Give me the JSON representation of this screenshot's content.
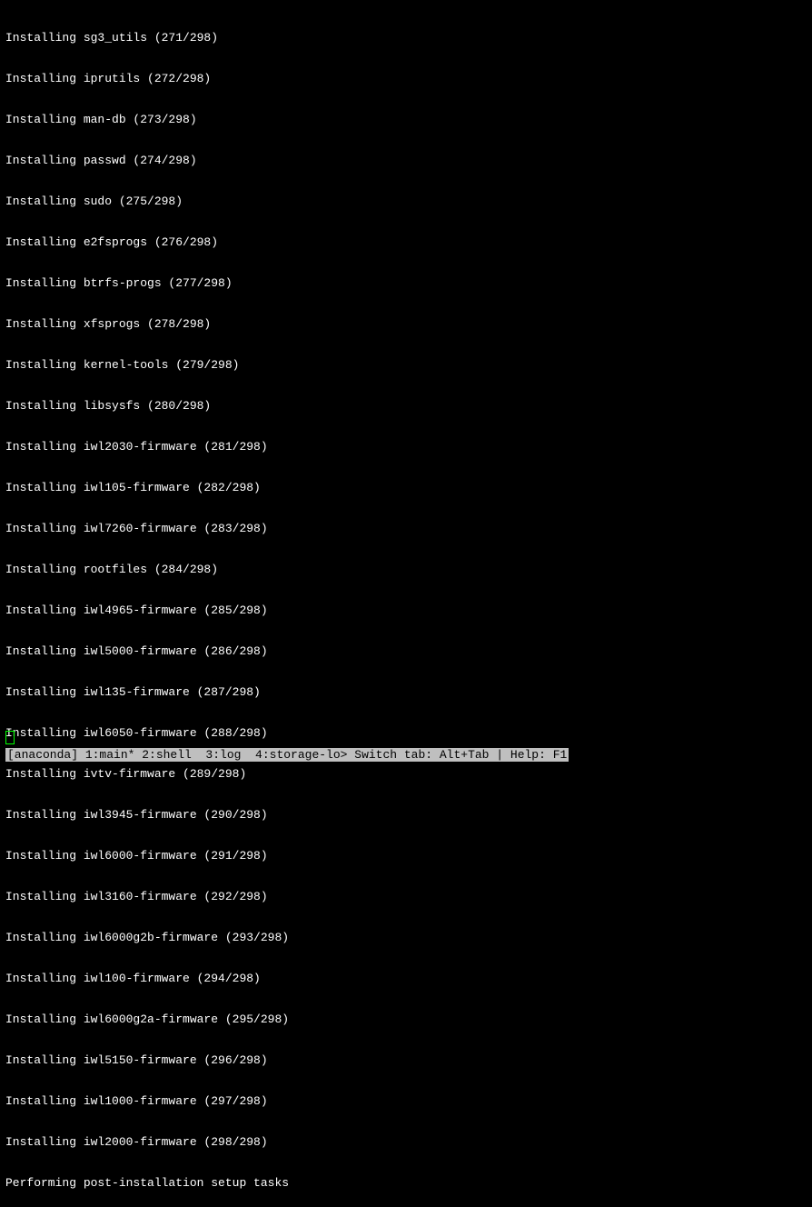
{
  "log": {
    "lines": [
      "Installing sg3_utils (271/298)",
      "Installing iprutils (272/298)",
      "Installing man-db (273/298)",
      "Installing passwd (274/298)",
      "Installing sudo (275/298)",
      "Installing e2fsprogs (276/298)",
      "Installing btrfs-progs (277/298)",
      "Installing xfsprogs (278/298)",
      "Installing kernel-tools (279/298)",
      "Installing libsysfs (280/298)",
      "Installing iwl2030-firmware (281/298)",
      "Installing iwl105-firmware (282/298)",
      "Installing iwl7260-firmware (283/298)",
      "Installing rootfiles (284/298)",
      "Installing iwl4965-firmware (285/298)",
      "Installing iwl5000-firmware (286/298)",
      "Installing iwl135-firmware (287/298)",
      "Installing iwl6050-firmware (288/298)",
      "Installing ivtv-firmware (289/298)",
      "Installing iwl3945-firmware (290/298)",
      "Installing iwl6000-firmware (291/298)",
      "Installing iwl3160-firmware (292/298)",
      "Installing iwl6000g2b-firmware (293/298)",
      "Installing iwl100-firmware (294/298)",
      "Installing iwl6000g2a-firmware (295/298)",
      "Installing iwl5150-firmware (296/298)",
      "Installing iwl1000-firmware (297/298)",
      "Installing iwl2000-firmware (298/298)",
      "Performing post-installation setup tasks"
    ]
  },
  "status_bar": {
    "text": "[anaconda] 1:main* 2:shell  3:log  4:storage-lo> Switch tab: Alt+Tab | Help: F1"
  }
}
